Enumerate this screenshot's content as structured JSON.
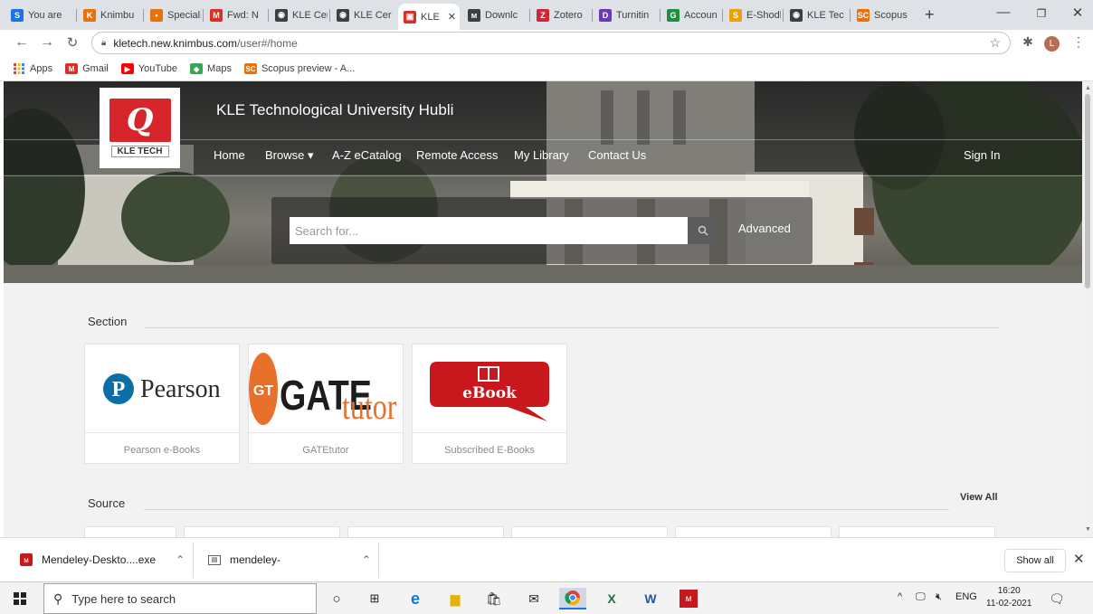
{
  "browser": {
    "tabs": [
      {
        "label": "You are",
        "icon": "S",
        "color": "#1a73e8"
      },
      {
        "label": "Knimbu",
        "icon": "K",
        "color": "#e8710a"
      },
      {
        "label": "Speciali",
        "icon": "▪",
        "color": "#e8710a"
      },
      {
        "label": "Fwd: N",
        "icon": "M",
        "color": "#d93025"
      },
      {
        "label": "KLE Cer",
        "icon": "◉",
        "color": "#3c4043"
      },
      {
        "label": "KLE Cer",
        "icon": "◉",
        "color": "#3c4043"
      },
      {
        "label": "KLE",
        "icon": "▣",
        "color": "#d93025"
      },
      {
        "label": "Downlc",
        "icon": "ᴍ",
        "color": "#3c4043"
      },
      {
        "label": "Zotero",
        "icon": "Z",
        "color": "#cc2936"
      },
      {
        "label": "Turnitin",
        "icon": "D",
        "color": "#6a3ab2"
      },
      {
        "label": "Accoun",
        "icon": "G",
        "color": "#1e8e3e"
      },
      {
        "label": "E-Shodl",
        "icon": "S",
        "color": "#e8a20a"
      },
      {
        "label": "KLE Tec",
        "icon": "◉",
        "color": "#3c4043"
      },
      {
        "label": "Scopus",
        "icon": "SC",
        "color": "#e8710a"
      }
    ],
    "new_tab": "+",
    "url_host": "kletech.new.knimbus.com",
    "url_path": "/user#/home",
    "profile_initial": "L",
    "bookmarks": [
      {
        "label": "Apps",
        "icon": "apps-icon",
        "color": "#1a73e8"
      },
      {
        "label": "Gmail",
        "icon": "M",
        "color": "#d93025"
      },
      {
        "label": "YouTube",
        "icon": "▶",
        "color": "#ff0000"
      },
      {
        "label": "Maps",
        "icon": "◆",
        "color": "#34a853"
      },
      {
        "label": "Scopus preview - A...",
        "icon": "SC",
        "color": "#e8710a"
      }
    ]
  },
  "site": {
    "university": "KLE Technological University Hubli",
    "logo_text": "KLE TECH",
    "nav": [
      "Home",
      "Browse ▾",
      "A-Z eCatalog",
      "Remote Access",
      "My Library",
      "Contact Us"
    ],
    "signin": "Sign In",
    "search_placeholder": "Search for...",
    "advanced": "Advanced",
    "section_title": "Section",
    "cards": [
      {
        "name": "Pearson e-Books",
        "brand": "Pearson"
      },
      {
        "name": "GATEtutor",
        "brand_a": "GATE",
        "brand_b": "tutor",
        "brand_gt": "GT"
      },
      {
        "name": "Subscribed E-Books",
        "brand": "eBook"
      }
    ],
    "source_title": "Source",
    "view_all": "View All"
  },
  "downloads": {
    "items": [
      "Mendeley-Deskto....exe",
      "mendeley-"
    ],
    "show_all": "Show all"
  },
  "taskbar": {
    "search_placeholder": "Type here to search",
    "time": "16:20",
    "date": "11-02-2021",
    "lang": "ENG"
  },
  "colors": {
    "kle_red": "#d7262b",
    "pearson_blue": "#0b6fa6",
    "gate_orange": "#e8702a",
    "ebook_red": "#c8181e"
  }
}
